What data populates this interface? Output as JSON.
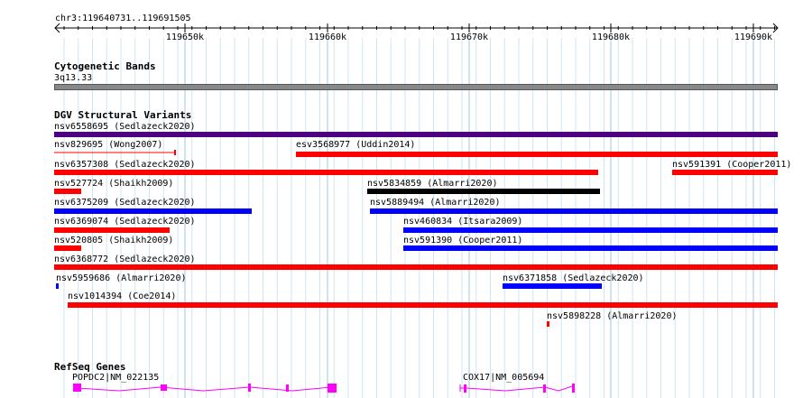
{
  "ruler": {
    "location": "chr3:119640731..119691505",
    "ticks": [
      "119650k",
      "119660k",
      "119670k",
      "119680k",
      "119690k"
    ]
  },
  "cytoband": {
    "title": "Cytogenetic Bands",
    "band": "3q13.33"
  },
  "dgv": {
    "title": "DGV Structural Variants",
    "colors": {
      "loss": "#ff0000",
      "gain": "#0000ff",
      "complex": "#000000",
      "inversion": "#4b0082"
    },
    "variants": [
      {
        "label": "nsv6558695 (Sedlazeck2020)",
        "color": "#4b0082"
      },
      {
        "label": "nsv829695 (Wong2007)",
        "color": "#ff0000",
        "style": "thin"
      },
      {
        "label": "esv3568977 (Uddin2014)",
        "color": "#ff0000"
      },
      {
        "label": "nsv6357308 (Sedlazeck2020)",
        "color": "#ff0000"
      },
      {
        "label": "nsv591391 (Cooper2011)",
        "color": "#ff0000"
      },
      {
        "label": "nsv527724 (Shaikh2009)",
        "color": "#ff0000"
      },
      {
        "label": "nsv5834859 (Almarri2020)",
        "color": "#000000"
      },
      {
        "label": "nsv6375209 (Sedlazeck2020)",
        "color": "#0000ff"
      },
      {
        "label": "nsv5889494 (Almarri2020)",
        "color": "#0000ff"
      },
      {
        "label": "nsv6369074 (Sedlazeck2020)",
        "color": "#ff0000"
      },
      {
        "label": "nsv460834 (Itsara2009)",
        "color": "#0000ff"
      },
      {
        "label": "nsv520805 (Shaikh2009)",
        "color": "#ff0000"
      },
      {
        "label": "nsv591390 (Cooper2011)",
        "color": "#0000ff"
      },
      {
        "label": "nsv6368772 (Sedlazeck2020)",
        "color": "#ff0000"
      },
      {
        "label": "nsv5959686 (Almarri2020)",
        "color": "#0000ff"
      },
      {
        "label": "nsv6371858 (Sedlazeck2020)",
        "color": "#0000ff"
      },
      {
        "label": "nsv1014394 (Coe2014)",
        "color": "#ff0000"
      },
      {
        "label": "nsv5898228 (Almarri2020)",
        "color": "#ff0000"
      }
    ]
  },
  "refseq": {
    "title": "RefSeq Genes",
    "color": "#ff00ff",
    "genes": [
      {
        "label": "POPDC2|NM_022135"
      },
      {
        "label": "COX17|NM_005694"
      }
    ]
  }
}
